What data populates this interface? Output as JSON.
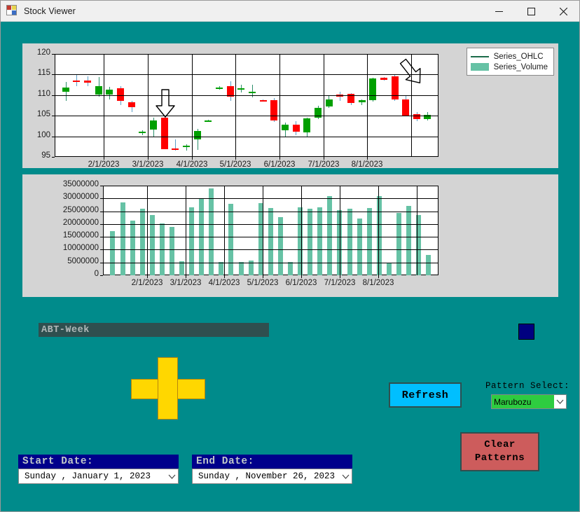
{
  "window": {
    "title": "Stock Viewer",
    "icon": "app-window-icon",
    "buttons": {
      "minimize": "minimize-icon",
      "maximize": "maximize-icon",
      "close": "close-icon"
    }
  },
  "colors": {
    "form_background": "#008b8b",
    "panel_background": "#d4d4d4",
    "candle_up": "#00a000",
    "candle_down": "#ff0000",
    "volume_bar": "#66c2a5",
    "ohlc_legend_line": "#1b6b4a",
    "refresh_button": "#00bfff",
    "clear_button": "#cd5c5c",
    "pattern_combo_highlight": "#2ecc40",
    "date_header": "#00008b",
    "pattern_label_background": "#2f4f4f",
    "color_swatch": "#000080",
    "cross_shape": "#ffd700"
  },
  "controls": {
    "pattern_name": "ABT-Week",
    "refresh_label": "Refresh",
    "pattern_select_label": "Pattern Select:",
    "pattern_select_value": "Marubozu",
    "clear_patterns_line1": "Clear",
    "clear_patterns_line2": "Patterns",
    "start_date_title": "Start Date:",
    "start_date_value": "Sunday  ,  January   1, 2023",
    "end_date_title": "End Date:",
    "end_date_value": "Sunday  ,  November  26, 2023"
  },
  "chart_data": [
    {
      "type": "candlestick",
      "name": "ohlc-chart",
      "title": "",
      "xlabel": "",
      "ylabel": "",
      "ylim": [
        95,
        120
      ],
      "yticks": [
        95,
        100,
        105,
        110,
        115,
        120
      ],
      "xticks": [
        "2/1/2023",
        "3/1/2023",
        "4/1/2023",
        "5/1/2023",
        "6/1/2023",
        "7/1/2023",
        "8/1/2023"
      ],
      "grid": true,
      "legend": [
        "Series_OHLC",
        "Series_Volume"
      ],
      "legend_position": "top-right",
      "annotations": [
        {
          "label": "pattern-arrow-1",
          "x_index": 9,
          "y": 106.5,
          "direction": "down"
        },
        {
          "label": "pattern-arrow-2",
          "x_index": 41,
          "y": 117.5,
          "direction": "down-left"
        }
      ],
      "candles": [
        {
          "o": 110.8,
          "h": 113.2,
          "l": 108.6,
          "c": 111.8
        },
        {
          "o": 113.6,
          "h": 115.0,
          "l": 112.2,
          "c": 113.5
        },
        {
          "o": 113.6,
          "h": 114.6,
          "l": 112.2,
          "c": 113.0
        },
        {
          "o": 110.1,
          "h": 114.4,
          "l": 109.6,
          "c": 112.2
        },
        {
          "o": 110.2,
          "h": 112.0,
          "l": 108.9,
          "c": 111.3
        },
        {
          "o": 111.7,
          "h": 112.2,
          "l": 107.6,
          "c": 108.6
        },
        {
          "o": 108.2,
          "h": 108.6,
          "l": 105.9,
          "c": 107.0
        },
        {
          "o": 100.9,
          "h": 101.5,
          "l": 100.3,
          "c": 101.2
        },
        {
          "o": 101.6,
          "h": 104.6,
          "l": 99.7,
          "c": 103.9
        },
        {
          "o": 104.6,
          "h": 104.7,
          "l": 96.9,
          "c": 96.9
        },
        {
          "o": 97.0,
          "h": 99.3,
          "l": 96.6,
          "c": 96.8
        },
        {
          "o": 97.4,
          "h": 98.1,
          "l": 96.5,
          "c": 97.8
        },
        {
          "o": 99.2,
          "h": 101.8,
          "l": 96.7,
          "c": 101.3
        },
        {
          "o": 103.7,
          "h": 104.0,
          "l": 103.6,
          "c": 103.9
        },
        {
          "o": 111.6,
          "h": 112.1,
          "l": 111.4,
          "c": 111.9
        },
        {
          "o": 112.2,
          "h": 113.3,
          "l": 108.6,
          "c": 109.6
        },
        {
          "o": 111.4,
          "h": 112.6,
          "l": 110.6,
          "c": 111.6
        },
        {
          "o": 110.8,
          "h": 112.6,
          "l": 109.4,
          "c": 110.9
        },
        {
          "o": 108.7,
          "h": 109.0,
          "l": 108.4,
          "c": 108.6
        },
        {
          "o": 108.8,
          "h": 109.3,
          "l": 103.5,
          "c": 103.8
        },
        {
          "o": 101.4,
          "h": 103.3,
          "l": 99.8,
          "c": 102.9
        },
        {
          "o": 102.9,
          "h": 103.6,
          "l": 100.2,
          "c": 101.2
        },
        {
          "o": 100.9,
          "h": 104.5,
          "l": 99.9,
          "c": 104.3
        },
        {
          "o": 104.5,
          "h": 107.4,
          "l": 104.2,
          "c": 106.9
        },
        {
          "o": 107.2,
          "h": 109.8,
          "l": 106.9,
          "c": 108.9
        },
        {
          "o": 110.2,
          "h": 110.9,
          "l": 108.6,
          "c": 109.7
        },
        {
          "o": 110.3,
          "h": 110.5,
          "l": 107.5,
          "c": 108.1
        },
        {
          "o": 108.2,
          "h": 109.0,
          "l": 107.6,
          "c": 108.7
        },
        {
          "o": 108.8,
          "h": 114.3,
          "l": 108.5,
          "c": 114.0
        },
        {
          "o": 114.2,
          "h": 114.4,
          "l": 113.6,
          "c": 113.7
        },
        {
          "o": 114.5,
          "h": 114.9,
          "l": 108.6,
          "c": 108.9
        },
        {
          "o": 109.0,
          "h": 109.9,
          "l": 104.8,
          "c": 105.1
        },
        {
          "o": 105.3,
          "h": 105.9,
          "l": 103.7,
          "c": 104.2
        },
        {
          "o": 104.2,
          "h": 105.8,
          "l": 103.8,
          "c": 105.2
        }
      ]
    },
    {
      "type": "bar",
      "name": "volume-chart",
      "title": "",
      "xlabel": "",
      "ylabel": "",
      "ylim": [
        0,
        35000000
      ],
      "yticks": [
        0,
        5000000,
        10000000,
        15000000,
        20000000,
        25000000,
        30000000,
        35000000
      ],
      "ytick_labels": [
        "0",
        "5000000",
        "10000000",
        "15000000",
        "20000000",
        "25000000",
        "30000000",
        "35000000"
      ],
      "xticks": [
        "2/1/2023",
        "3/1/2023",
        "4/1/2023",
        "5/1/2023",
        "6/1/2023",
        "7/1/2023",
        "8/1/2023"
      ],
      "grid": true,
      "series_name": "Series_Volume",
      "values": [
        17300000,
        28400000,
        21200000,
        26100000,
        23600000,
        20100000,
        18900000,
        5600000,
        26600000,
        30000000,
        33800000,
        5300000,
        27800000,
        5100000,
        5800000,
        28100000,
        26300000,
        22700000,
        5200000,
        26500000,
        26000000,
        26400000,
        30800000,
        25500000,
        26100000,
        22200000,
        26300000,
        31000000,
        4600000,
        24300000,
        27000000,
        23500000,
        8000000
      ]
    }
  ]
}
